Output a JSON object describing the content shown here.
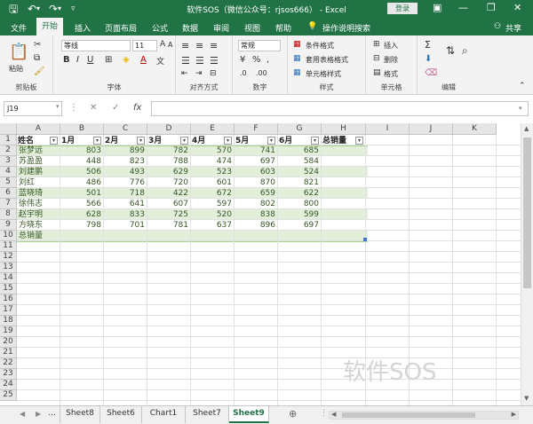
{
  "titlebar": {
    "title": "软件SOS（微信公众号：rjsos666） - Excel",
    "login": "登录",
    "save_icon": "save-icon",
    "undo_icon": "undo-icon",
    "redo_icon": "redo-icon"
  },
  "menu": {
    "file": "文件",
    "home": "开始",
    "insert": "插入",
    "page_layout": "页面布局",
    "formulas": "公式",
    "data": "数据",
    "review": "审阅",
    "view": "视图",
    "help": "帮助",
    "tell_me": "操作说明搜索",
    "share": "共享"
  },
  "ribbon": {
    "paste": "粘贴",
    "clipboard": "剪贴板",
    "font_name": "等线",
    "font_size": "11",
    "font_group": "字体",
    "alignment_group": "对齐方式",
    "number_format": "常规",
    "number_group": "数字",
    "conditional_format": "条件格式",
    "table_format": "套用表格格式",
    "cell_styles": "单元格样式",
    "styles_group": "样式",
    "insert": "插入",
    "delete": "删除",
    "format": "格式",
    "cells_group": "单元格",
    "editing_group": "编辑"
  },
  "formula_bar": {
    "name_box": "J19",
    "fx": "fx",
    "value": ""
  },
  "sheet": {
    "columns": [
      "A",
      "B",
      "C",
      "D",
      "E",
      "F",
      "G",
      "H",
      "I",
      "J",
      "K"
    ],
    "rows": [
      "1",
      "2",
      "3",
      "4",
      "5",
      "6",
      "7",
      "8",
      "9",
      "10",
      "11",
      "12",
      "13",
      "14",
      "15",
      "16",
      "17",
      "18",
      "19",
      "20",
      "21",
      "22",
      "23",
      "24",
      "25"
    ],
    "headers": [
      "姓名",
      "1月",
      "2月",
      "3月",
      "4月",
      "5月",
      "6月",
      "总销量"
    ],
    "data": [
      [
        "张梦远",
        "803",
        "899",
        "782",
        "570",
        "741",
        "685"
      ],
      [
        "苏盈盈",
        "448",
        "823",
        "788",
        "474",
        "697",
        "584"
      ],
      [
        "刘建鹏",
        "506",
        "493",
        "629",
        "523",
        "603",
        "524"
      ],
      [
        "刘红",
        "486",
        "776",
        "720",
        "601",
        "870",
        "821"
      ],
      [
        "蓝晓琦",
        "501",
        "718",
        "422",
        "672",
        "659",
        "622"
      ],
      [
        "徐伟志",
        "566",
        "641",
        "607",
        "597",
        "802",
        "800"
      ],
      [
        "赵宇明",
        "628",
        "833",
        "725",
        "520",
        "838",
        "599"
      ],
      [
        "方晓东",
        "798",
        "701",
        "781",
        "637",
        "896",
        "697"
      ]
    ],
    "total_row_label": "总销量"
  },
  "tabs": {
    "ellipsis": "...",
    "sheets": [
      "Sheet8",
      "Sheet6",
      "Chart1",
      "Sheet7",
      "Sheet9"
    ],
    "active": "Sheet9",
    "add_icon": "plus-icon"
  },
  "watermark": "软件SOS",
  "colors": {
    "brand": "#217346",
    "band": "#e2efda",
    "text_green": "#375623"
  }
}
